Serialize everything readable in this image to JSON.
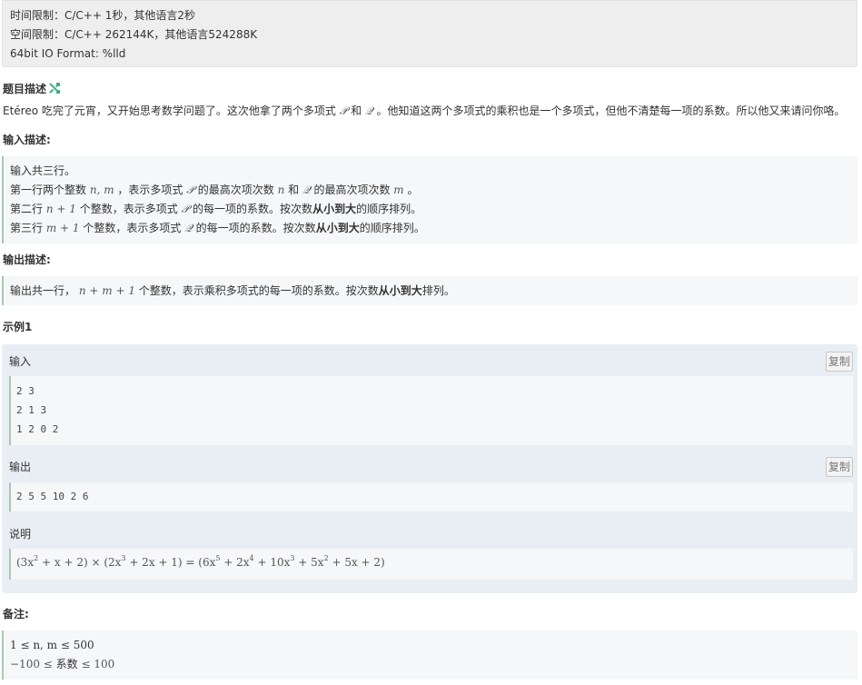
{
  "limits": {
    "time": "时间限制：C/C++ 1秒，其他语言2秒",
    "space": "空间限制：C/C++ 262144K，其他语言524288K",
    "format": "64bit IO Format: %lld"
  },
  "description": {
    "title": "题目描述",
    "icon": "shuffle-icon",
    "text_before_p": "Etéreo 吃完了元宵，又开始思考数学问题了。这次他拿了两个多项式",
    "P": "𝒫",
    "and": "和",
    "Q": "𝒬",
    "text_after_q": "。他知道这两个多项式的乘积也是一个多项式，但他不清楚每一项的系数。所以他又来请问你咯。"
  },
  "input": {
    "title": "输入描述:",
    "line1": "输入共三行。",
    "line2": {
      "t1": "第一行两个整数",
      "m1": "n, m",
      "t2": "，表示多项式",
      "P": "𝒫",
      "t3": "的最高次项次数",
      "n": "n",
      "t4": "和",
      "Q": "𝒬",
      "t5": "的最高次项次数",
      "m": "m",
      "t6": "。"
    },
    "line3": {
      "t1": "第二行",
      "m1": "n + 1",
      "t2": "个整数，表示多项式",
      "P": "𝒫",
      "t3": "的每一项的系数。按次数",
      "b": "从小到大",
      "t4": "的顺序排列。"
    },
    "line4": {
      "t1": "第三行",
      "m1": "m + 1",
      "t2": "个整数，表示多项式",
      "Q": "𝒬",
      "t3": "的每一项的系数。按次数",
      "b": "从小到大",
      "t4": "的顺序排列。"
    }
  },
  "output": {
    "title": "输出描述:",
    "t1": "输出共一行，",
    "m1": "n + m + 1",
    "t2": "个整数，表示乘积多项式的每一项的系数。按次数",
    "b": "从小到大",
    "t3": "排列。"
  },
  "example": {
    "title": "示例1",
    "input_label": "输入",
    "copy_label": "复制",
    "input_lines": [
      "2 3",
      "2 1 3",
      "1 2 0 2"
    ],
    "output_label": "输出",
    "output_lines": [
      "2 5 5 10 2 6"
    ],
    "explain_label": "说明",
    "explain": {
      "p1": "(3x",
      "e1": "2",
      "p2": " + x + 2) × (2x",
      "e2": "3",
      "p3": " + 2x + 1) = (6x",
      "e3": "5",
      "p4": " + 2x",
      "e4": "4",
      "p5": " + 10x",
      "e5": "3",
      "p6": " + 5x",
      "e6": "2",
      "p7": " + 5x + 2)"
    }
  },
  "notes": {
    "title": "备注:",
    "line1": "1 ≤ n, m ≤ 500",
    "line2_a": "−100 ≤",
    "line2_b": "系数",
    "line2_c": "≤ 100"
  },
  "colors": {
    "accent": "#a9c8b2",
    "panel": "#eeeeee",
    "example_bg": "#e9eef4",
    "icon": "#2aa876"
  }
}
